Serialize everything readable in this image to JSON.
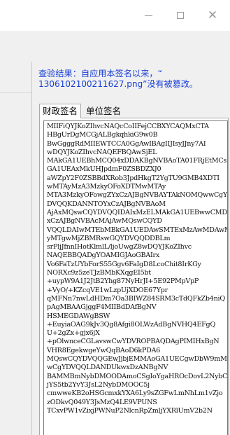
{
  "window": {
    "buttons": {
      "minimize": "—",
      "maximize": "☐",
      "close": "✕"
    }
  },
  "result": {
    "line1": "查验结果：自应用本签名以来，“",
    "line2": "1306102100211627.png”没有被篡改。"
  },
  "tabs": [
    {
      "label": "财政签名",
      "active": true
    },
    {
      "label": "单位签名",
      "active": false
    }
  ],
  "certificate_text": [
    "MIIFiQYJKoZIhvcNAQcCoIIFejCCBXYCAQMxCTA",
    "HBgUrDgMCGjALBgkqhkiG9w0B",
    "BwGgggRdMIIEWTCCA0GgAwIBAgIIJIsyJJny7AI",
    "wDQYJKoZIhvcNAQEFBQAwSjEL",
    "MAkGA1UEBhMCQ04xDDAKBgNVBAoTA01FRjEtMCs",
    "GA1UEAxMkUHJpdmF0ZSBDZXJ0",
    "aWZpY2F0ZSBBdXRob3JpdHkgT2YgTU9GMB4XDTI",
    "wMTAyMzA3MzkyOFoXDTMwMTAy",
    "MTA3MzkyOFowgZYxCzAJBgNVBAYTAkNOMQwwCgY",
    "DVQQKDANNTOYxCzAJBgNVBAoM",
    "AjAxMQswCQYDVQQIDAIxMzELMAkGA1UEBwwCMDA",
    "xCzAJBgNVBAcMAjAwMQswCQYD",
    "VQQLDAIwMTEbMBkGA1UEDAwSMTExMzAwMDAwMDA",
    "yMTgwMjZBMRswGQYDVQQDDBLm",
    "srPljJfnnIHotKlmlL/ljoUwgZ8wDQYJKoZIhvc",
    "NAQEBBQADgYOAMIGJAoGBAIrx",
    "Vo6FaTzUYbForS55Ggv6FaIgD8LcoChit8IrKGy",
    "NORXc9z5zeTJzBMbKXqgEI5bt",
    "+uypW9A1J2JtB2Yhg87NyHrJI+5E92PMpVpP",
    "+VyO/+KZcqVE1wLzpUjXDOE67Ypr",
    "qMFNn7nwLdHDm7Oa3BIWZ84SRM3cTdQFkZb4niQ",
    "pAgMBAAGjggF4MIIBdDAfBgNV",
    "HSMEGDAWgBSW",
    "+EuyiaOAG9kJv3Qg8Afgi8OLWzAdBgNVHQ4EFgQ",
    "U+2gZx+gjx6jX",
    "+pOlwnceCGLavswCwYDVROPBAQDAgPIMIHxBgN",
    "VHR8EgekwgeYwQqBAoD6kPDA6",
    "MQswCQYDVQQGEwJjbjEMMAoGA1UECgwDbW9mMQw",
    "wCgYDVQQLDANDUkwxDzANBgNV",
    "BAMMBmNybDMOODAmoCSgIoYgaHROcDovL2NybC5",
    "jYS5tb2YvY3JsL2NybDMOOC5j",
    "cmwweKB2oHSGcmxkYXA6Ly9sZGFwLmNhLm1vZjo",
    "zODkvQ049Y3JsMzQ4LE9VPUNS",
    "TCxvPW1vZixjPWNuP2NlcnRpZmljYXRlUmV2b2N"
  ]
}
